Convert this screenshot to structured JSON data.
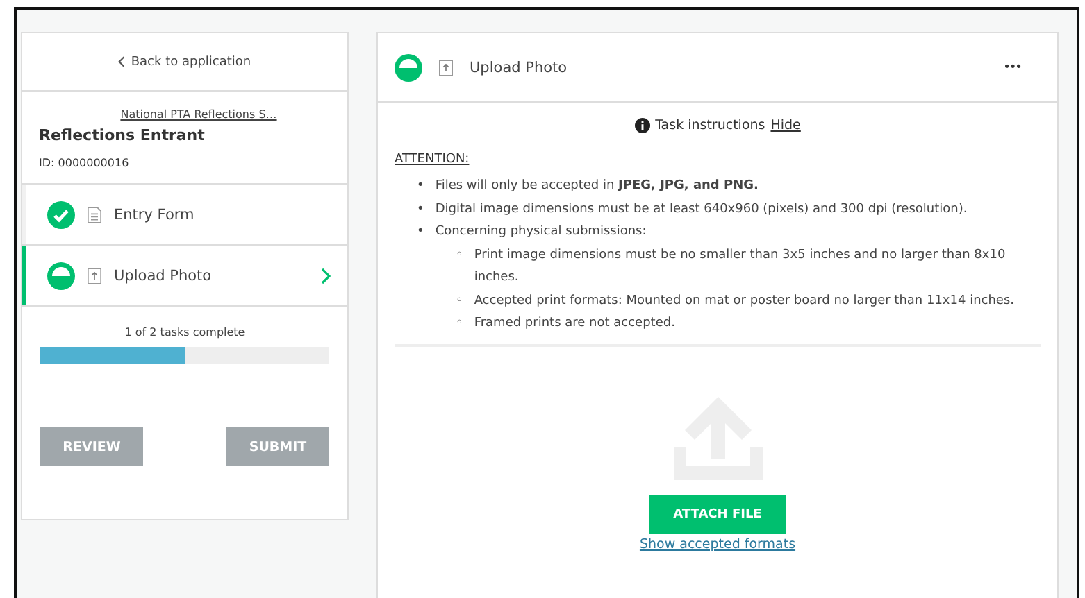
{
  "sidebar": {
    "back_link": "Back to application",
    "program_link": "National PTA Reflections S…",
    "title": "Reflections Entrant",
    "id_text": "ID: 0000000016",
    "tasks": [
      {
        "label": "Entry Form",
        "complete": true,
        "selected": false
      },
      {
        "label": "Upload Photo",
        "complete": false,
        "selected": true
      }
    ],
    "progress": {
      "label": "1 of 2 tasks complete",
      "level": 0.5
    },
    "buttons": [
      "REVIEW",
      "SUBMIT"
    ]
  },
  "task": {
    "title": "Upload Photo",
    "complete": false,
    "menu": "•••",
    "instructions_label": "Task instructions",
    "hide_link": "Hide",
    "heading": "ATTENTION:",
    "items": [
      {
        "bullet": "•",
        "text": "Files will only be accepted in **JPEG, JPG, and PNG.**"
      },
      {
        "bullet": "•",
        "text": "Digital image dimensions must be at least 640x960 (pixels) and 300 dpi (resolution)."
      },
      {
        "bullet": "•",
        "text": "Concerning physical submissions:",
        "children": [
          {
            "bullet": "◦",
            "text": "Print image dimensions must be no smaller than 3x5 inches and no larger than 8x10 inches."
          },
          {
            "bullet": "◦",
            "text": "Accepted print formats: Mounted on mat or poster board no larger than 11x14 inches."
          },
          {
            "bullet": "◦",
            "text": "Framed prints are not accepted."
          }
        ]
      }
    ],
    "attach_button": "ATTACH FILE",
    "formats_link": "Show accepted formats"
  }
}
